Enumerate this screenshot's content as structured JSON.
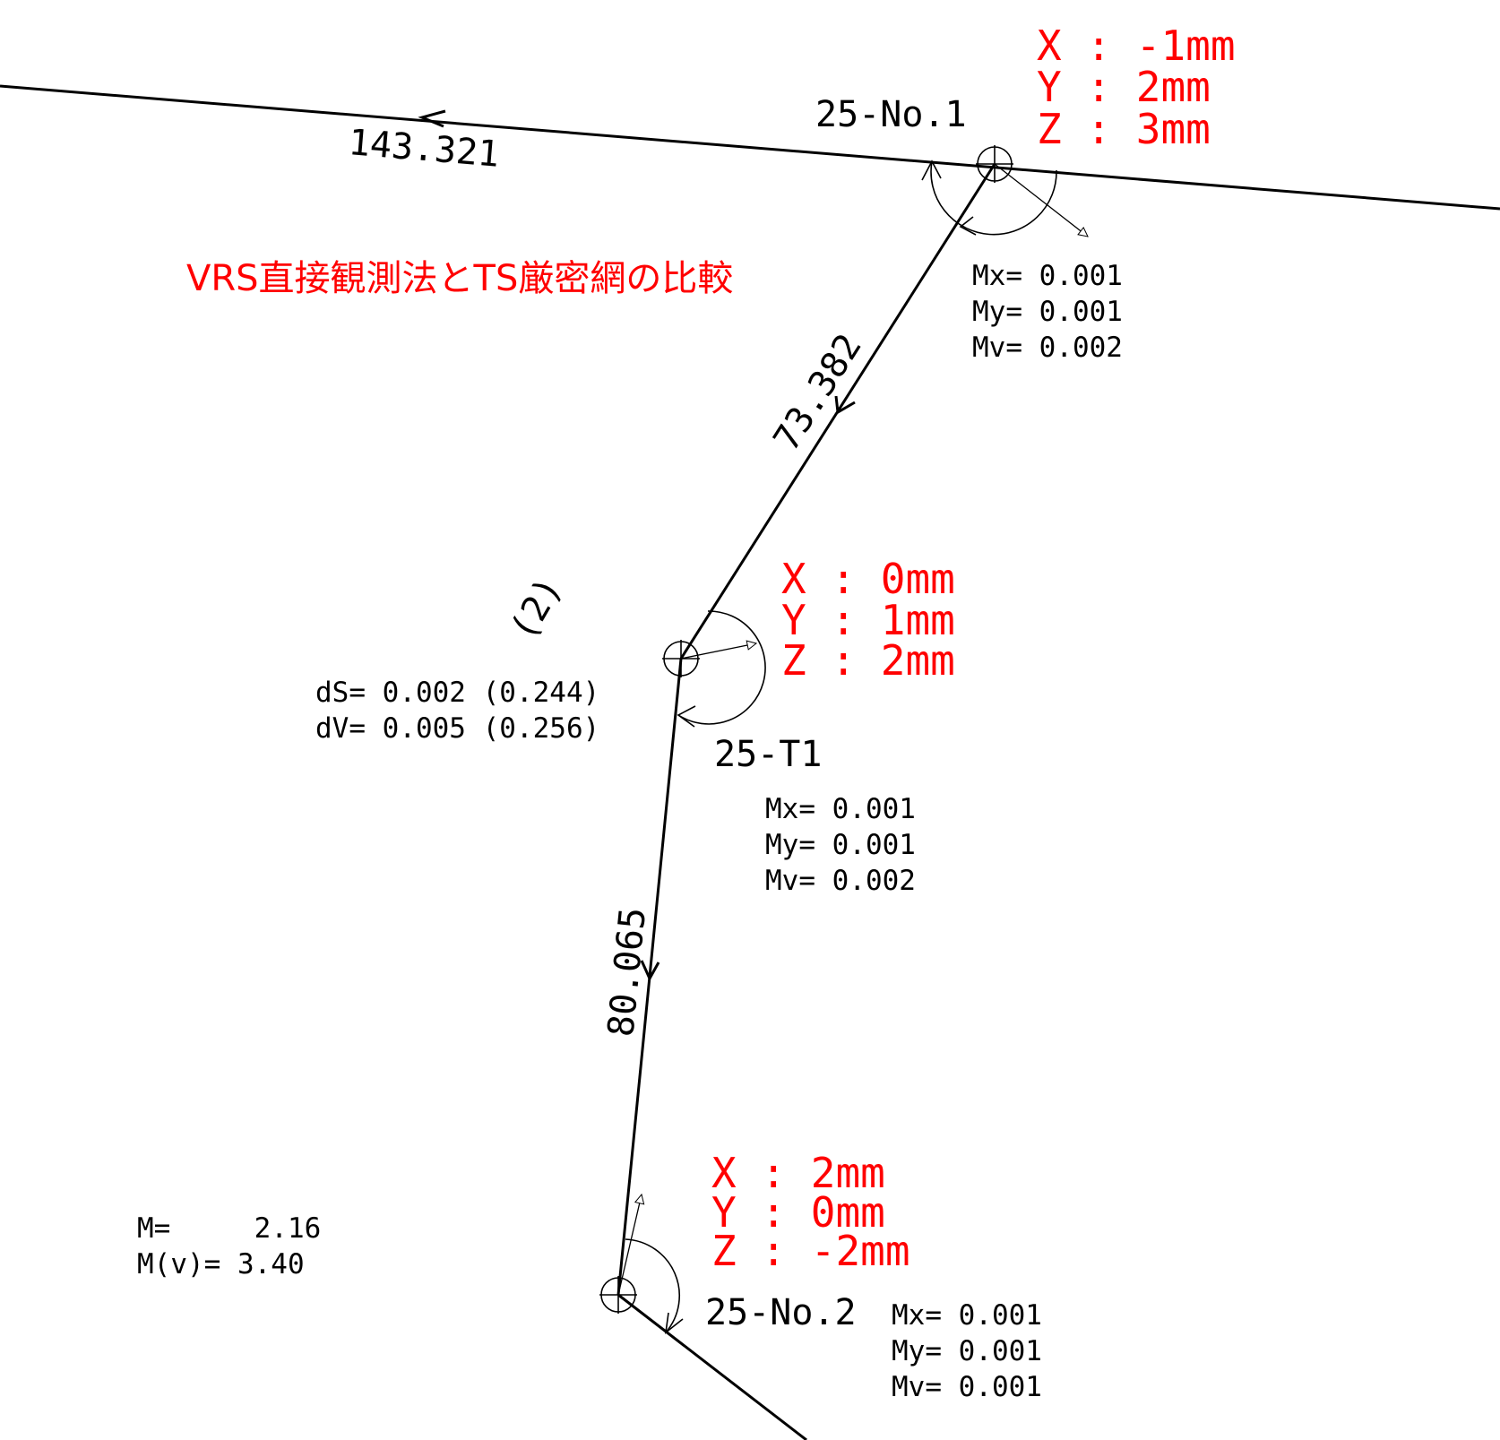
{
  "title": "VRS直接観測法とTS厳密網の比較",
  "summary": {
    "m_line": "M=     2.16",
    "mv_line": "M(v)= 3.40"
  },
  "net_label": "(2)",
  "diffs": {
    "ds_line": "dS= 0.002 (0.244)",
    "dv_line": "dV= 0.005 (0.256)"
  },
  "distances": {
    "top": "143.321",
    "leg1": "73.382",
    "leg2": "80.065"
  },
  "points": {
    "no1": {
      "name": "25-No.1",
      "x": "X : -1mm",
      "y": "Y : 2mm",
      "z": "Z : 3mm",
      "mx": "Mx= 0.001",
      "my": "My= 0.001",
      "mv": "Mv= 0.002"
    },
    "t1": {
      "name": "25-T1",
      "x": "X : 0mm",
      "y": "Y : 1mm",
      "z": "Z : 2mm",
      "mx": "Mx= 0.001",
      "my": "My= 0.001",
      "mv": "Mv= 0.002"
    },
    "no2": {
      "name": "25-No.2",
      "x": "X : 2mm",
      "y": "Y : 0mm",
      "z": "Z : -2mm",
      "mx": "Mx= 0.001",
      "my": "My= 0.001",
      "mv": "Mv= 0.001"
    }
  },
  "colors": {
    "line": "#000000",
    "error_text": "#ff0000"
  }
}
